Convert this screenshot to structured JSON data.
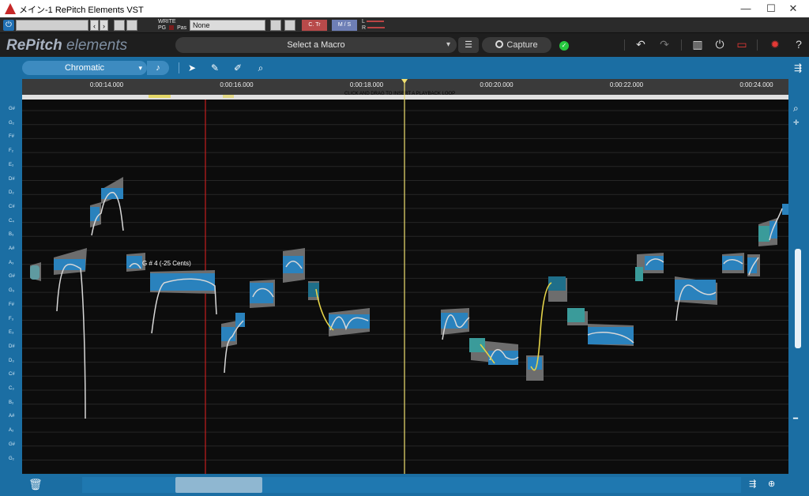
{
  "window": {
    "title": "メイン-1 RePitch Elements VST",
    "minimize": "—",
    "maximize": "☐",
    "close": "✕"
  },
  "host": {
    "write_label": "WRITE",
    "pg_label": "PG",
    "pas_label": "Pas",
    "preset_value": "None",
    "ctr_label": "C. Tr",
    "ms_label": "M / S",
    "l_label": "L",
    "r_label": "R"
  },
  "toolbar": {
    "logo_bold": "RePitch",
    "logo_light": "elements",
    "macro_label": "Select a Macro",
    "capture_label": "Capture",
    "icons": [
      "sliders-icon",
      "undo-icon",
      "redo-icon",
      "columns-icon",
      "power-icon",
      "record-icon",
      "settings-icon",
      "help-icon"
    ]
  },
  "editor": {
    "scale_mode": "Chromatic",
    "tools": [
      "pointer-tool",
      "pen-tool",
      "brush-tool",
      "zoom-tool"
    ],
    "loop_hint": "CLICK AND DRAG TO INSERT A PLAYBACK LOOP",
    "time_ticks": [
      "0:00:14.000",
      "0:00:16.000",
      "0:00:18.000",
      "0:00:20.000",
      "0:00:22.000",
      "0:00:24.000"
    ],
    "note_labels": [
      "G#",
      "G₂",
      "F#",
      "F₂",
      "E₂",
      "D#",
      "D₂",
      "C#",
      "C₄",
      "B₃",
      "A#",
      "A₃",
      "G#",
      "G₃",
      "F#",
      "F₃",
      "E₃",
      "D#",
      "D₃",
      "C#",
      "C₃",
      "B₂",
      "A#",
      "A₂",
      "G#",
      "G₂"
    ],
    "hover_note": "G # 4 (-25 Cents)",
    "colors": {
      "accent": "#1b6ea3",
      "blob": "#2a82bd",
      "curve": "#d8d8d8",
      "edit_curve": "#e5d449",
      "playhead": "#f0e070",
      "cursor": "#c41e1e"
    }
  }
}
